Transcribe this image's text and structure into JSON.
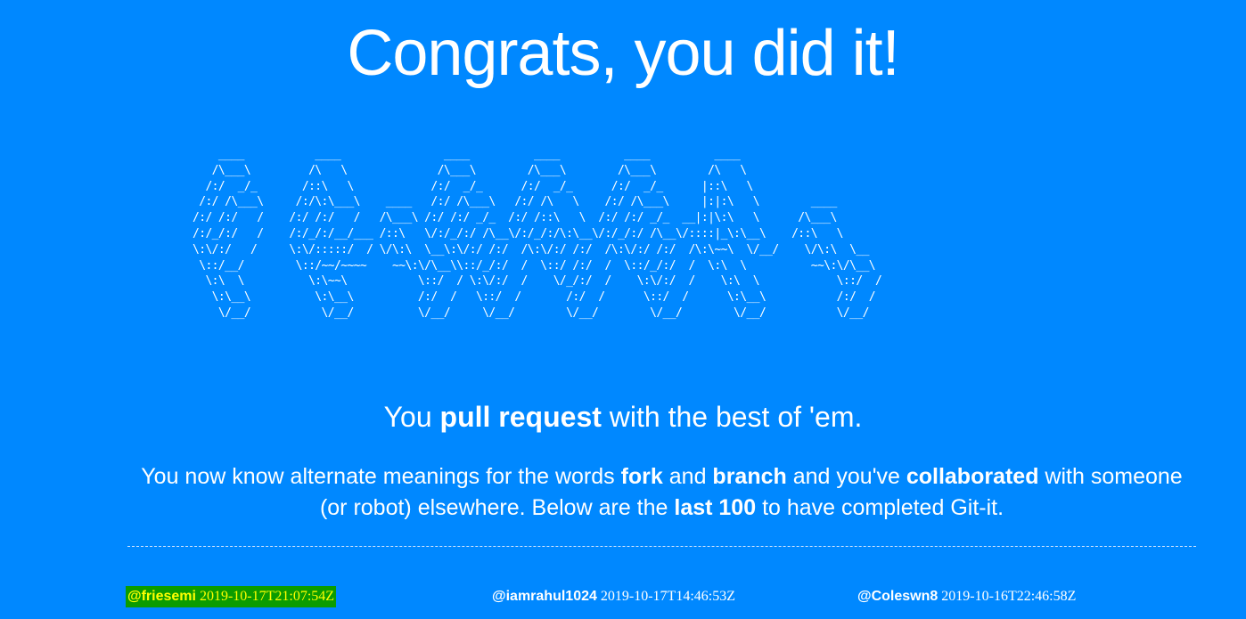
{
  "page": {
    "title": "Congrats, you did it!",
    "ascii_art": "    ____           ____                ____          ____          ____          ____\n   /\\___\\         /\\   \\              /\\___\\        /\\___\\        /\\___\\        /\\   \\\n  /:/  _/_       /::\\   \\            /:/  _/_      /:/  _/_      /:/  _/_      |::\\   \\\n /:/ /\\___\\     /:/\\:\\___\\    ____   /:/ /\\___\\   /:/ /\\   \\    /:/ /\\___\\     |:|:\\   \\        ____\n/:/ /:/   /    /:/ /:/   /   /\\___\\ /:/ /:/ _/_  /:/ /::\\   \\  /:/ /:/ _/_  __|:|\\:\\   \\      /\\___\\\n/:/_/:/   /    /:/_/:/__/___ /::\\   \\/:/_/:/ /\\__\\/:/_/:/\\:\\__\\/:/_/:/ /\\__\\/::::|_\\:\\__\\    /::\\   \\\n\\:\\/:/   /     \\:\\/:::::/  / \\/\\:\\  \\__\\:\\/:/ /:/  /\\:\\/:/ /:/  /\\:\\/:/ /:/  /\\:\\~~\\  \\/__/    \\/\\:\\  \\__\n \\::/__/        \\::/~~/~~~~    ~~\\:\\/\\__\\\\::/_/:/  /  \\::/ /:/  /  \\::/_/:/  /  \\:\\  \\          ~~\\:\\/\\__\\\n  \\:\\  \\          \\:\\~~\\           \\::/  / \\:\\/:/  /    \\/_/:/  /    \\:\\/:/  /    \\:\\  \\            \\::/  /\n   \\:\\__\\          \\:\\__\\          /:/  /   \\::/  /       /:/  /      \\::/  /      \\:\\__\\           /:/  /\n    \\/__/           \\/__/          \\/__/     \\/__/        \\/__/        \\/__/        \\/__/           \\/__/",
    "tagline": {
      "prefix": "You ",
      "bold": "pull request",
      "suffix": " with the best of 'em."
    },
    "description": {
      "part1": "You now know alternate meanings for the words ",
      "bold1": "fork",
      "part2": " and ",
      "bold2": "branch",
      "part3": " and you've ",
      "bold3": "collaborated",
      "part4": " with someone (or robot) elsewhere. Below are the ",
      "bold4": "last 100",
      "part5": " to have completed Git-it."
    }
  },
  "completers": [
    {
      "username": "@friesemi",
      "timestamp": "2019-10-17T21:07:54Z",
      "highlighted": true
    },
    {
      "username": "@iamrahul1024",
      "timestamp": "2019-10-17T14:46:53Z",
      "highlighted": false
    },
    {
      "username": "@Coleswn8",
      "timestamp": "2019-10-16T22:46:58Z",
      "highlighted": false
    }
  ],
  "colors": {
    "background": "#0088ff",
    "text": "#ffffff",
    "highlight_background": "#0b9c00",
    "highlight_text": "#ffff00"
  }
}
